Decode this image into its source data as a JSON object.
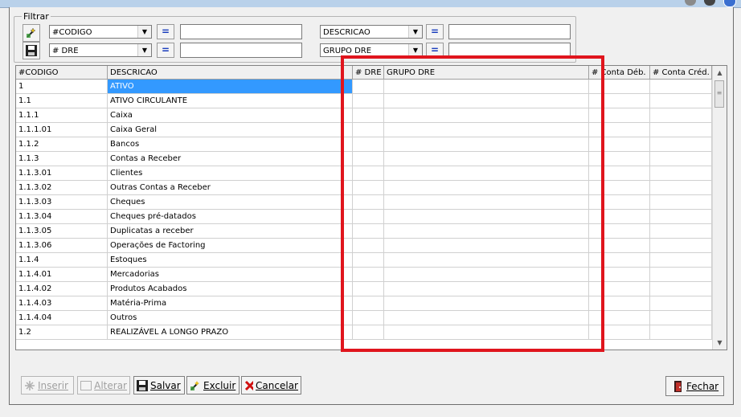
{
  "filter": {
    "legend": "Filtrar",
    "row1": {
      "field_a": "#CODIGO",
      "eq_a": "=",
      "field_b": "DESCRICAO",
      "eq_b": "="
    },
    "row2": {
      "field_a": "# DRE",
      "eq_a": "=",
      "field_b": "GRUPO DRE",
      "eq_b": "="
    }
  },
  "grid": {
    "columns": [
      "#CODIGO",
      "DESCRICAO",
      "# DRE",
      "GRUPO DRE",
      "# Conta Déb.",
      "# Conta Créd."
    ],
    "rows": [
      [
        "1",
        "ATIVO"
      ],
      [
        "1.1",
        "ATIVO CIRCULANTE"
      ],
      [
        "1.1.1",
        "Caixa"
      ],
      [
        "1.1.1.01",
        "Caixa Geral"
      ],
      [
        "1.1.2",
        "Bancos"
      ],
      [
        "1.1.3",
        "Contas a Receber"
      ],
      [
        "1.1.3.01",
        "Clientes"
      ],
      [
        "1.1.3.02",
        "Outras Contas a Receber"
      ],
      [
        "1.1.3.03",
        "Cheques"
      ],
      [
        "1.1.3.04",
        "Cheques pré-datados"
      ],
      [
        "1.1.3.05",
        "Duplicatas a receber"
      ],
      [
        "1.1.3.06",
        "Operações de Factoring"
      ],
      [
        "1.1.4",
        "Estoques"
      ],
      [
        "1.1.4.01",
        "Mercadorias"
      ],
      [
        "1.1.4.02",
        "Produtos Acabados"
      ],
      [
        "1.1.4.03",
        "Matéria-Prima"
      ],
      [
        "1.1.4.04",
        "Outros"
      ],
      [
        "1.2",
        "REALIZÁVEL A LONGO PRAZO"
      ]
    ]
  },
  "buttons": {
    "inserir": "Inserir",
    "alterar": "Alterar",
    "salvar": "Salvar",
    "excluir": "Excluir",
    "cancelar": "Cancelar",
    "fechar": "Fechar"
  },
  "colors": {
    "highlight": "#e0151d",
    "selection": "#3399ff"
  }
}
